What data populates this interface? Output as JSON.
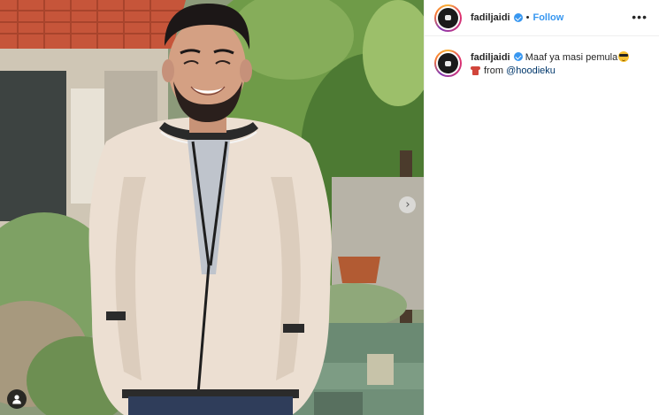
{
  "post": {
    "username": "fadiljaidi",
    "verified_icon": "verified-badge-icon",
    "follow_separator": "•",
    "follow_label": "Follow",
    "more_label": "•••",
    "caption": {
      "username": "fadiljaidi",
      "line1": "Maaf ya masi pemula",
      "line2_prefix": "from",
      "mention": "@hoodieku",
      "emojis": [
        "sunglasses-emoji",
        "t-shirt-emoji"
      ]
    },
    "media": {
      "next_icon": "›",
      "tag_icon": "user-tag-icon"
    },
    "colors": {
      "link": "#3897f0",
      "mention": "#00376b",
      "text": "#262626"
    }
  }
}
